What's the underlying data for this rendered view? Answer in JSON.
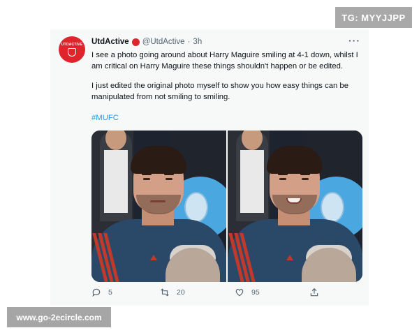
{
  "watermarks": {
    "top": "TG: MYYJJPP",
    "bottom": "www.go-2ecircle.com"
  },
  "tweet": {
    "author": {
      "name": "UtdActive",
      "handle": "@UtdActive",
      "separator": "·",
      "time": "3h",
      "avatar_text": "UTDACTIVE"
    },
    "more_label": "···",
    "paragraphs": [
      "I see a photo going around about Harry Maguire smiling at 4-1 down, whilst I am critical on Harry Maguire these things shouldn't happen or be edited.",
      "I just edited the original photo myself to show you how easy things can be manipulated from not smiling to smiling."
    ],
    "hashtag": "#MUFC",
    "images": [
      {
        "expression": "not-smiling"
      },
      {
        "expression": "smiling"
      }
    ],
    "metrics": {
      "replies": "5",
      "retweets": "20",
      "likes": "95"
    }
  },
  "colors": {
    "accent": "#1d9bf0",
    "avatar": "#e0242b",
    "watermark": "#a9a9a9"
  },
  "icons": [
    "reply-icon",
    "retweet-icon",
    "like-icon",
    "share-icon",
    "more-icon",
    "verified-badge-icon"
  ]
}
